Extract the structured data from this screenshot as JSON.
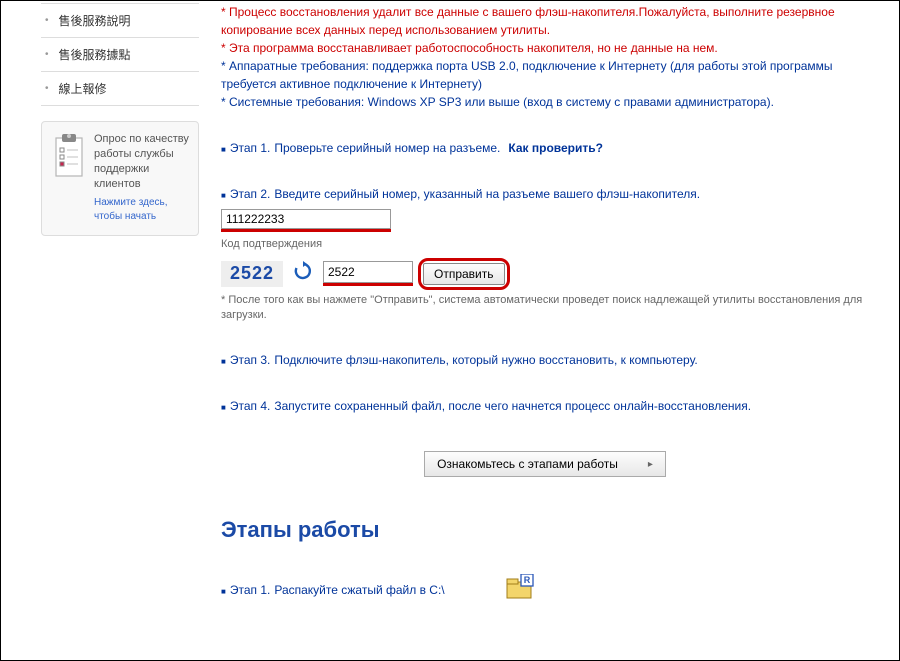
{
  "sidebar": {
    "items": [
      {
        "label": "售後服務說明"
      },
      {
        "label": "售後服務據點"
      },
      {
        "label": "線上報修"
      }
    ],
    "survey": {
      "text": "Опрос по качеству работы службы поддержки клиентов",
      "link": "Нажмите здесь, чтобы начать"
    }
  },
  "main": {
    "warning_line1": "* Процесс восстановления удалит все данные с вашего флэш-накопителя.Пожалуйста, выполните резервное копирование всех данных перед использованием утилиты.",
    "warning_line2": "* Эта программа восстанавливает работоспособность накопителя, но не данные на нем.",
    "req1": "* Аппаратные требования: поддержка порта USB 2.0, подключение к Интернету (для работы этой программы требуется активное подключение к Интернету)",
    "req2": "* Системные требования: Windows XP SP3 или выше (вход в систему с правами администратора).",
    "step1_prefix": "Этап 1.",
    "step1_text": "Проверьте серийный номер на разъеме.",
    "step1_link": "Как проверить?",
    "step2_prefix": "Этап 2.",
    "step2_text": "Введите серийный номер, указанный на разъеме вашего флэш-накопителя.",
    "serial_value": "111222233",
    "confirm_label": "Код подтверждения",
    "captcha_code": "2522",
    "captcha_value": "2522",
    "submit_label": "Отправить",
    "submit_note": "* После того как вы нажмете \"Отправить\", система автоматически проведет поиск надлежащей утилиты восстановления для загрузки.",
    "step3_prefix": "Этап 3.",
    "step3_text": "Подключите флэш-накопитель, который нужно восстановить, к компьютеру.",
    "step4_prefix": "Этап 4.",
    "step4_text": "Запустите сохраненный файл, после чего начнется процесс онлайн-восстановления.",
    "workflow_btn": "Ознакомьтесь с этапами работы",
    "workflow_heading": "Этапы работы",
    "workflow_step1_prefix": "Этап 1.",
    "workflow_step1_text": "Распакуйте сжатый файл в C:\\"
  }
}
